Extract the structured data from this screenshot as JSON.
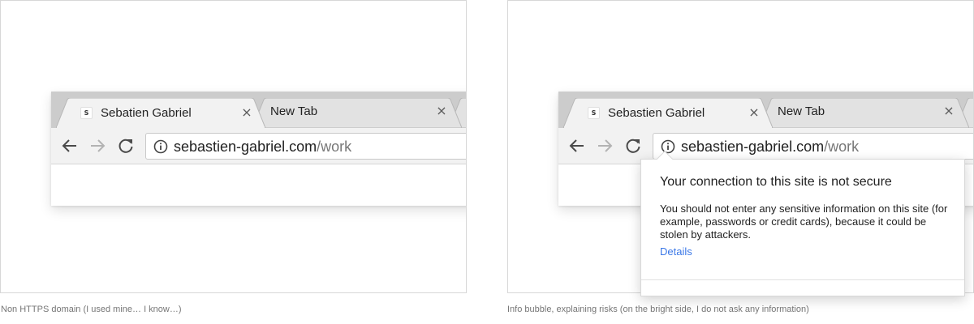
{
  "panels": {
    "left": {
      "caption": "Non HTTPS domain (I used mine… I know…)",
      "browser": {
        "favicon_letter": "S",
        "active_tab_title": "Sebatien Gabriel",
        "inactive_tab_title": "New Tab",
        "close_glyph": "×",
        "url_host": "sebastien-gabriel.com",
        "url_path": "/work"
      }
    },
    "right": {
      "caption": "Info bubble, explaining risks (on the bright side, I do not ask any information)",
      "browser": {
        "favicon_letter": "S",
        "active_tab_title": "Sebastien Gabriel",
        "inactive_tab_title": "New Tab",
        "close_glyph": "×",
        "url_host": "sebastien-gabriel.com",
        "url_path": "/work"
      },
      "bubble": {
        "title": "Your connection to this site is not secure",
        "body": "You should not enter any sensitive information on this site (for example, passwords or credit cards), because it could be stolen by attackers.",
        "link": "Details"
      }
    }
  },
  "icons": [
    "back-arrow-icon",
    "forward-arrow-icon",
    "reload-icon",
    "info-icon",
    "close-icon",
    "favicon-icon"
  ],
  "colors": {
    "tabstrip": "#cccccc",
    "toolbar": "#f2f2f2",
    "link": "#3b78e7",
    "url_path": "#777777",
    "forward_disabled": "#b3b3b3"
  }
}
